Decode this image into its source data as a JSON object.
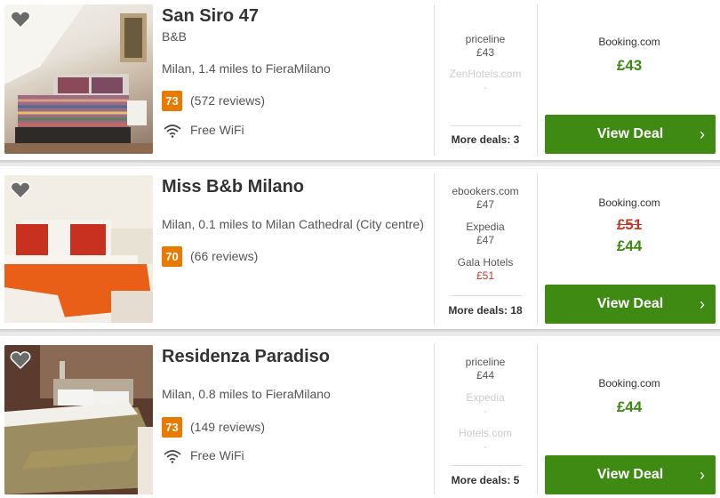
{
  "hotels": [
    {
      "name": "San Siro 47",
      "type": "B&B",
      "location": "Milan, 1.4 miles to FieraMilano",
      "score": "73",
      "reviews": "(572 reviews)",
      "amenity": "Free WiFi",
      "deals": [
        {
          "site": "priceline",
          "price": "£43",
          "faded": false
        },
        {
          "site": "ZenHotels.com",
          "price": "-",
          "faded": true
        }
      ],
      "more_deals": "More deals: 3",
      "main_site": "Booking.com",
      "old_price": "",
      "main_price": "£43",
      "button_label": "View Deal"
    },
    {
      "name": "Miss B&b Milano",
      "type": "",
      "location": "Milan, 0.1 miles to Milan Cathedral (City centre)",
      "score": "70",
      "reviews": "(66 reviews)",
      "amenity": "",
      "deals": [
        {
          "site": "ebookers.com",
          "price": "£47",
          "faded": false
        },
        {
          "site": "Expedia",
          "price": "£47",
          "faded": false
        },
        {
          "site": "Gala Hotels",
          "price": "£51",
          "faded": false
        }
      ],
      "more_deals": "More deals: 18",
      "main_site": "Booking.com",
      "old_price": "£51",
      "main_price": "£44",
      "button_label": "View Deal"
    },
    {
      "name": "Residenza Paradiso",
      "type": "",
      "location": "Milan, 0.8 miles to FieraMilano",
      "score": "73",
      "reviews": "(149 reviews)",
      "amenity": "Free WiFi",
      "deals": [
        {
          "site": "priceline",
          "price": "£44",
          "faded": false
        },
        {
          "site": "Expedia",
          "price": "-",
          "faded": true
        },
        {
          "site": "Hotels.com",
          "price": "-",
          "faded": true
        }
      ],
      "more_deals": "More deals: 5",
      "main_site": "Booking.com",
      "old_price": "",
      "main_price": "£44",
      "button_label": "View Deal"
    }
  ],
  "colors": {
    "score_badge": "#e87a00",
    "deal_button": "#3f8a13",
    "price_green": "#3c8a13",
    "price_red": "#c0392b"
  },
  "icons": {
    "favorite": "heart-icon",
    "wifi": "wifi-icon",
    "button_arrow": "chevron-right-icon"
  }
}
